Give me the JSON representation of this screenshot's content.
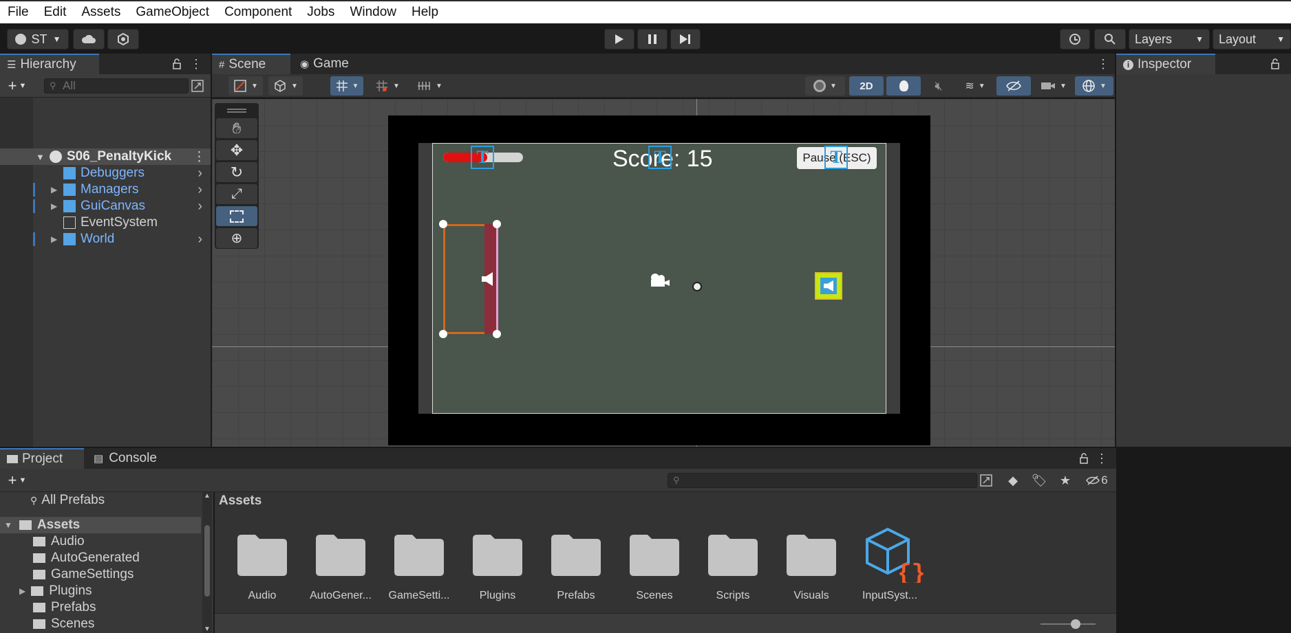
{
  "menu": [
    "File",
    "Edit",
    "Assets",
    "GameObject",
    "Component",
    "Jobs",
    "Window",
    "Help"
  ],
  "toolbar": {
    "account": "ST",
    "layers_label": "Layers",
    "layout_label": "Layout"
  },
  "hierarchy": {
    "tab": "Hierarchy",
    "search_placeholder": "All",
    "scene_name": "S06_PenaltyKick",
    "items": [
      {
        "label": "Debuggers",
        "prefab": true
      },
      {
        "label": "Managers",
        "prefab": true
      },
      {
        "label": "GuiCanvas",
        "prefab": true
      },
      {
        "label": "EventSystem",
        "prefab": false
      },
      {
        "label": "World",
        "prefab": true
      }
    ]
  },
  "scene_view": {
    "tabs": [
      "Scene",
      "Game"
    ],
    "mode_2d": "2D",
    "hud_score": "Score: 15",
    "hud_pause": "Pause (ESC)",
    "health_fill": 0.55
  },
  "inspector": {
    "tab": "Inspector"
  },
  "bottom": {
    "tabs": [
      "Project",
      "Console"
    ],
    "tree": {
      "favorite": "All Prefabs",
      "root": "Assets",
      "children": [
        "Audio",
        "AutoGenerated",
        "GameSettings",
        "Plugins",
        "Prefabs",
        "Scenes"
      ]
    },
    "breadcrumb": "Assets",
    "hidden_count": "6",
    "assets": [
      "Audio",
      "AutoGener...",
      "GameSetti...",
      "Plugins",
      "Prefabs",
      "Scenes",
      "Scripts",
      "Visuals",
      "InputSyst..."
    ]
  },
  "colors": {
    "accent": "#3a79bb",
    "prefab_blue": "#7cb6ff",
    "health_red": "#e01010",
    "goal_orange": "#d2691e"
  }
}
